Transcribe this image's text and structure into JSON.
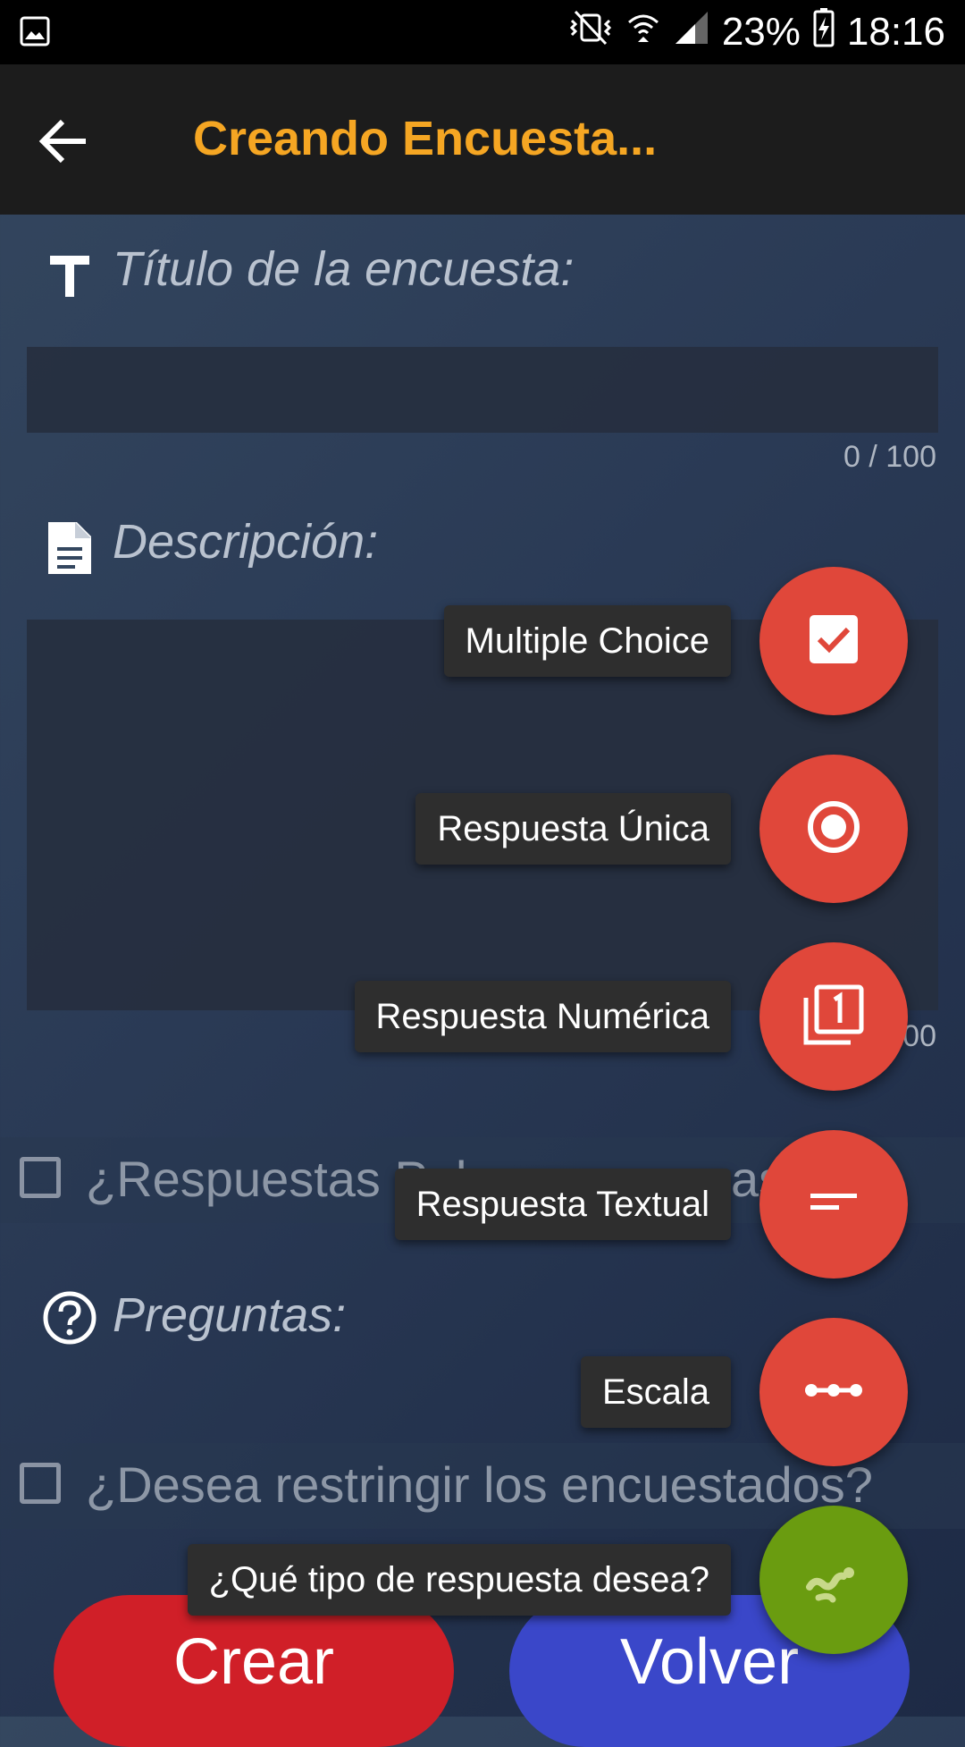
{
  "status_bar": {
    "battery": "23%",
    "time": "18:16"
  },
  "toolbar": {
    "title": "Creando Encuesta..."
  },
  "form": {
    "title_label": "Título de la encuesta:",
    "title_counter": "0 / 100",
    "description_label": "Descripción:",
    "description_counter_partial": "00",
    "public_results_checkbox": "¿Respuestas Pub.",
    "public_results_tail": "as",
    "questions_label": "Preguntas:",
    "restrict_checkbox": "¿Desea restringir los encuestados?"
  },
  "fab_menu": {
    "items": [
      {
        "label": "Multiple Choice",
        "icon": "checkbox-icon"
      },
      {
        "label": "Respuesta Única",
        "icon": "radio-button-icon"
      },
      {
        "label": "Respuesta Numérica",
        "icon": "numbered-stack-icon"
      },
      {
        "label": "Respuesta Textual",
        "icon": "short-text-icon"
      },
      {
        "label": "Escala",
        "icon": "scale-icon"
      }
    ],
    "main_label": "¿Qué tipo de respuesta desea?",
    "main_icon": "gesture-icon"
  },
  "buttons": {
    "create": "Crear",
    "back": "Volver"
  },
  "colors": {
    "accent": "#f5a623",
    "fab": "#e0473a",
    "fab_main": "#6a9c10",
    "create_button": "#d01f28",
    "back_button": "#3a47c9"
  }
}
